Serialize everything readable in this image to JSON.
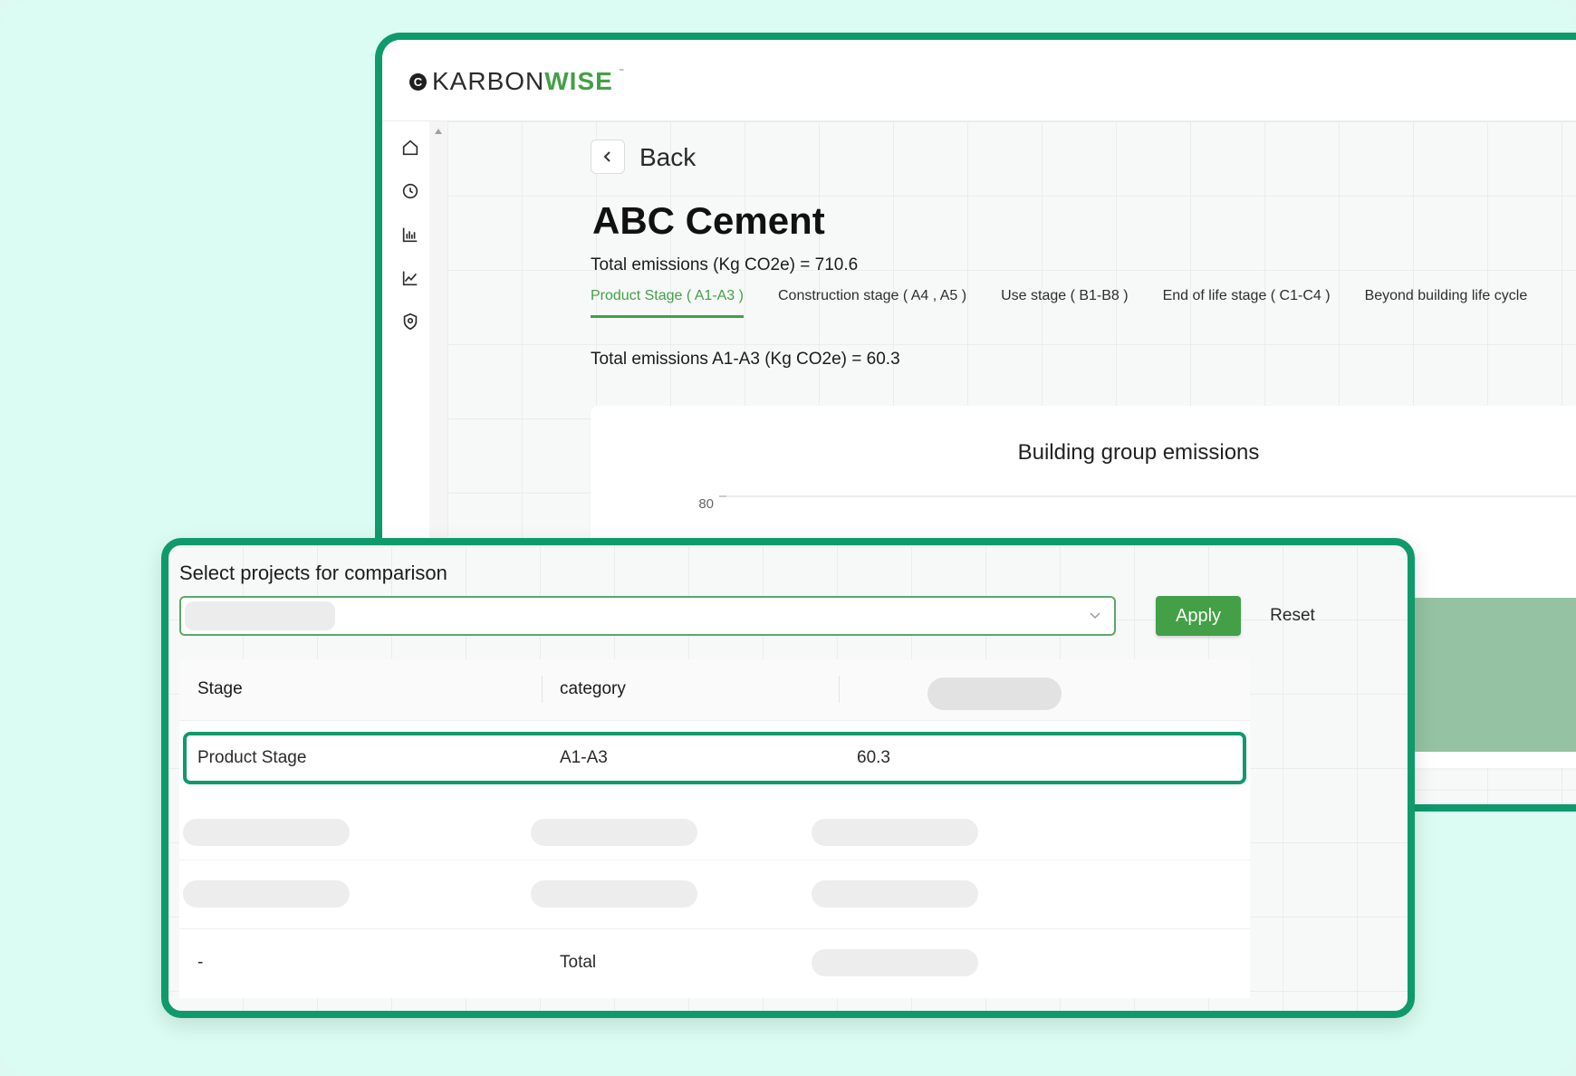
{
  "brand": {
    "logo_mark": "C",
    "name_part1": "KARBON",
    "name_part2": "WISE",
    "tm": "™"
  },
  "sidebar": {
    "items": [
      {
        "icon": "home-icon"
      },
      {
        "icon": "history-icon"
      },
      {
        "icon": "bar-chart-icon"
      },
      {
        "icon": "line-chart-icon"
      },
      {
        "icon": "shield-icon"
      }
    ]
  },
  "page": {
    "back_label": "Back",
    "project_title": "ABC Cement",
    "total_emissions": "Total emissions (Kg CO2e)  =  710.6",
    "tabs": [
      {
        "label": "Product Stage ( A1-A3 )",
        "active": true
      },
      {
        "label": "Construction stage ( A4 , A5 )",
        "active": false
      },
      {
        "label": "Use stage ( B1-B8 )",
        "active": false
      },
      {
        "label": "End of life stage ( C1-C4 )",
        "active": false
      },
      {
        "label": "Beyond building life cycle",
        "active": false
      }
    ],
    "stage_total": "Total emissions A1-A3 (Kg CO2e)  =  60.3"
  },
  "chart_data": {
    "type": "bar",
    "title": "Building group emissions",
    "y_ticks": [
      "80"
    ]
  },
  "comparison": {
    "title": "Select projects for comparison",
    "apply_label": "Apply",
    "reset_label": "Reset",
    "table": {
      "headers": [
        "Stage",
        "category"
      ],
      "highlight_row": {
        "stage": "Product Stage",
        "category": "A1-A3",
        "value": "60.3"
      },
      "total_row": {
        "stage": "-",
        "category": "Total"
      }
    }
  },
  "colors": {
    "accent": "#0f9a6b",
    "brand_green": "#43a047",
    "background": "#dbfcf2"
  }
}
